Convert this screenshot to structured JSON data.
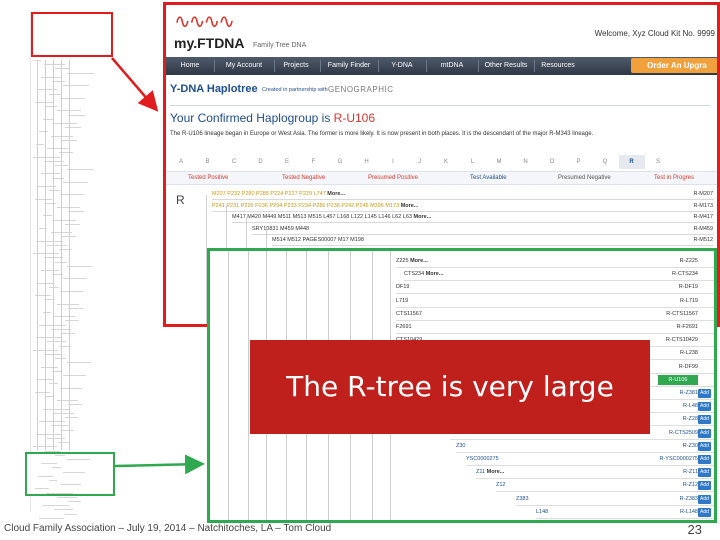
{
  "site": {
    "logo_text": "my.FTDNA",
    "logo_sub": "Family Tree DNA",
    "welcome": "Welcome, Xyz Cloud Kit No. 9999"
  },
  "nav": {
    "items": [
      "Home",
      "My Account",
      "Projects",
      "Family Finder",
      "Y-DNA",
      "mtDNA",
      "Other Results",
      "Resources"
    ],
    "order_button": "Order An Upgra"
  },
  "haplotree": {
    "title": "Y-DNA Haplotree",
    "partner": "Created in partnership with",
    "genographic": "GENOGRAPHIC",
    "confirmed_prefix": "Your Confirmed Haplogroup is ",
    "confirmed_hg": "R-U106",
    "description": "The R-U106 lineage began in Europe or West Asia. The former is more likely. It is now present in both places. It is the descendant of the major R-M343 lineage.",
    "letters": [
      "A",
      "B",
      "C",
      "D",
      "E",
      "F",
      "G",
      "H",
      "I",
      "J",
      "K",
      "L",
      "M",
      "N",
      "O",
      "P",
      "Q",
      "R",
      "S"
    ],
    "active_letter": "R",
    "tabs": [
      "Tested Positive",
      "Tested Negative",
      "Presumed Positive",
      "Test Available",
      "Presumed Negative",
      "Test in Progres"
    ],
    "branch_letter": "R",
    "rows": [
      {
        "snps": "M207 P232 P280 P285 P224 P227 P229 L747",
        "more": "More...",
        "right": "R-M207"
      },
      {
        "snps": "P241 P231 P225 P236 P294 P233 P234 P286 P238 P242 P245 M306 M173",
        "more": "More...",
        "right": "R-M173"
      },
      {
        "snps": "M417 M420 M449 M511 M513 M515 L457 L168 L122 L145 L146 L62 L63",
        "more": "More...",
        "right": "R-M417"
      },
      {
        "snps": "SRY10831 M459 M448",
        "more": "",
        "right": "R-M459"
      },
      {
        "snps": "M514 M512 PAGES00007 M17 M198",
        "more": "",
        "right": "R-M512"
      }
    ]
  },
  "detail": {
    "rows": [
      {
        "left": "Z225",
        "more": "More...",
        "right": "R-Z225",
        "add": false
      },
      {
        "left": "CTS234",
        "more": "More...",
        "right": "R-CTS234",
        "add": false
      },
      {
        "left": "DF19",
        "more": "",
        "right": "R-DF19",
        "add": false
      },
      {
        "left": "L719",
        "more": "",
        "right": "R-L719",
        "add": false
      },
      {
        "left": "CTS11567",
        "more": "",
        "right": "R-CTS11567",
        "add": false
      },
      {
        "left": "F2691",
        "more": "",
        "right": "R-F2691",
        "add": false
      },
      {
        "left": "CTS10429",
        "more": "",
        "right": "R-CTS10429",
        "add": false
      },
      {
        "left": "L238",
        "more": "",
        "right": "R-L238",
        "add": false
      },
      {
        "left": "DF99",
        "more": "",
        "right": "R-DF99",
        "add": false
      },
      {
        "left": "U106",
        "more": "",
        "right": "R-U106",
        "add": false
      },
      {
        "left": "Z381",
        "more": "",
        "right": "R-Z381",
        "add": true
      },
      {
        "left": "L48",
        "more": "",
        "right": "R-L48",
        "add": true
      },
      {
        "left": "Z28",
        "more": "",
        "right": "R-Z28",
        "add": true
      },
      {
        "left": "CTS2509",
        "more": "More...",
        "right": "R-CTS2509",
        "add": true
      },
      {
        "left": "Z30",
        "more": "",
        "right": "R-Z30",
        "add": true
      },
      {
        "left": "YSC0000275",
        "more": "",
        "right": "R-YSC0000275",
        "add": true
      },
      {
        "left": "Z11",
        "more": "More...",
        "right": "R-Z11",
        "add": true
      },
      {
        "left": "Z12",
        "more": "",
        "right": "R-Z12",
        "add": true
      },
      {
        "left": "Z383",
        "more": "",
        "right": "R-Z383",
        "add": true
      },
      {
        "left": "L148",
        "more": "",
        "right": "R-L148",
        "add": true
      }
    ],
    "add_label": "Add",
    "highlight": "R-U106"
  },
  "callout": "The R-tree is very large",
  "footer": "Cloud Family Association – July 19, 2014 – Natchitoches, LA – Tom Cloud",
  "page_number": "23",
  "colors": {
    "red": "#e01c1c",
    "green": "#2fa84f",
    "callout": "#c0201c",
    "navy": "#1f4e8c"
  }
}
